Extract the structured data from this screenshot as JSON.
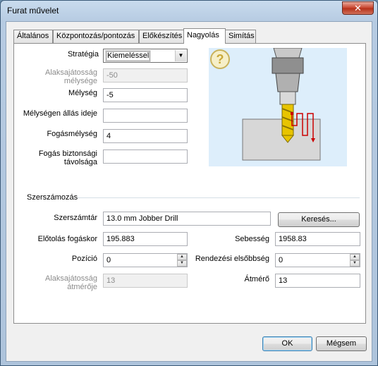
{
  "window": {
    "title": "Furat művelet",
    "close_glyph": "✕"
  },
  "tabs": [
    {
      "label": "Általános"
    },
    {
      "label": "Központozás/pontozás"
    },
    {
      "label": "Előkészítés"
    },
    {
      "label": "Nagyolás",
      "active": true
    },
    {
      "label": "Simítás"
    }
  ],
  "roughing": {
    "strategy": {
      "label": "Stratégia",
      "value": "Kiemeléssel"
    },
    "relative_depth": {
      "label": "Alaksajátosság mélysége",
      "value": "-50"
    },
    "depth": {
      "label": "Mélység",
      "value": "-5"
    },
    "dwell_time": {
      "label": "Mélységen állás ideje",
      "value": ""
    },
    "step_depth": {
      "label": "Fogásmélység",
      "value": "4"
    },
    "safety_distance": {
      "label": "Fogás biztonsági távolsága",
      "value": ""
    }
  },
  "help_icon": "question-icon",
  "tooling": {
    "group_label": "Szerszámozás",
    "library": {
      "label": "Szerszámtár",
      "value": "13.0 mm Jobber Drill"
    },
    "search_button": "Keresés...",
    "feed": {
      "label": "Előtolás fogáskor",
      "value": "195.883"
    },
    "speed": {
      "label": "Sebesség",
      "value": "1958.83"
    },
    "position": {
      "label": "Pozíció",
      "value": "0"
    },
    "sort_priority": {
      "label": "Rendezési elsőbbség",
      "value": "0"
    },
    "feature_diameter": {
      "label": "Alaksajátosság átmérője",
      "value": "13"
    },
    "diameter": {
      "label": "Átmérő",
      "value": "13"
    }
  },
  "footer": {
    "ok": "OK",
    "cancel": "Mégsem"
  },
  "colors": {
    "accent": "#3c7fb1",
    "drill_bit": "#e8c400",
    "path_line": "#cc0000"
  }
}
